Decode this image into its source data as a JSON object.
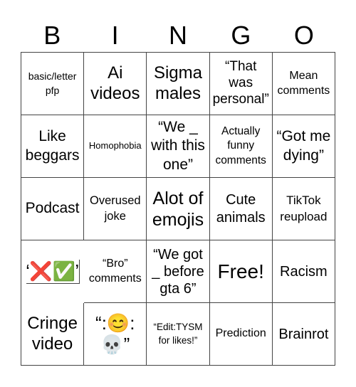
{
  "header": {
    "letters": [
      "B",
      "I",
      "N",
      "G",
      "O"
    ]
  },
  "cells": [
    "basic/letter pfp",
    "Ai videos",
    "Sigma males",
    "“That was personal”",
    "Mean comments",
    "Like beggars",
    "Homophobia",
    "“We _ with this one”",
    "Actually funny comments",
    "“Got me dying”",
    "Podcast",
    "Overused joke",
    "Alot of emojis",
    "Cute animals",
    "TikTok reupload",
    "“❌✅”",
    "“Bro” comments",
    "“We got _ before gta 6”",
    "Free!",
    "Racism",
    "Cringe video",
    "“:😊:💀”",
    "“Edit:TYSM for likes!”",
    "Prediction",
    "Brainrot"
  ]
}
